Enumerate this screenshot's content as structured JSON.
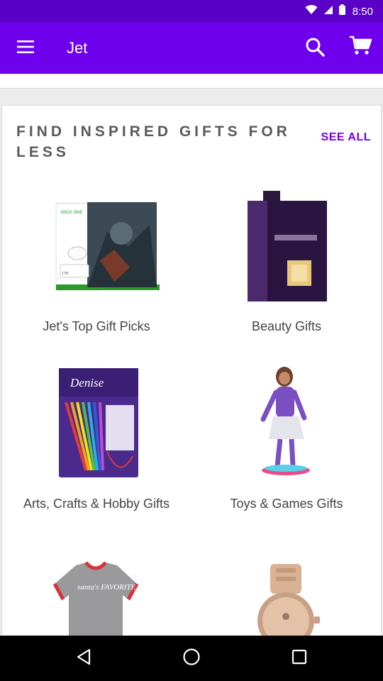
{
  "status_bar": {
    "time": "8:50",
    "icons": [
      "wifi-icon",
      "cellular-signal-icon",
      "battery-icon"
    ]
  },
  "app_bar": {
    "title": "Jet",
    "icons": [
      "menu-icon",
      "search-icon",
      "cart-icon"
    ]
  },
  "section": {
    "heading": "FIND INSPIRED GIFTS FOR LESS",
    "see_all_label": "SEE ALL"
  },
  "gift_tiles": [
    {
      "label": "Jet's Top Gift Picks",
      "image": "game-console-bundle"
    },
    {
      "label": "Beauty Gifts",
      "image": "perfume-bottle"
    },
    {
      "label": "Arts, Crafts & Hobby Gifts",
      "image": "knitting-needles-set"
    },
    {
      "label": "Toys & Games Gifts",
      "image": "doll-figure"
    },
    {
      "label": "",
      "image": "baby-onesie"
    },
    {
      "label": "",
      "image": "wristwatch"
    }
  ],
  "products": {
    "console_brand": "XBOX ONE",
    "console_storage": "1TB",
    "knitting_brand": "Denise",
    "onesie_text": "santa's FAVORITE"
  },
  "nav_bar": {
    "icons": [
      "back-icon",
      "home-icon",
      "recents-icon"
    ]
  },
  "colors": {
    "status_bar": "#5b00c7",
    "app_bar": "#6e00ee",
    "accent": "#6e00ee",
    "heading_text": "#5a5a5a",
    "background": "#ececec"
  }
}
